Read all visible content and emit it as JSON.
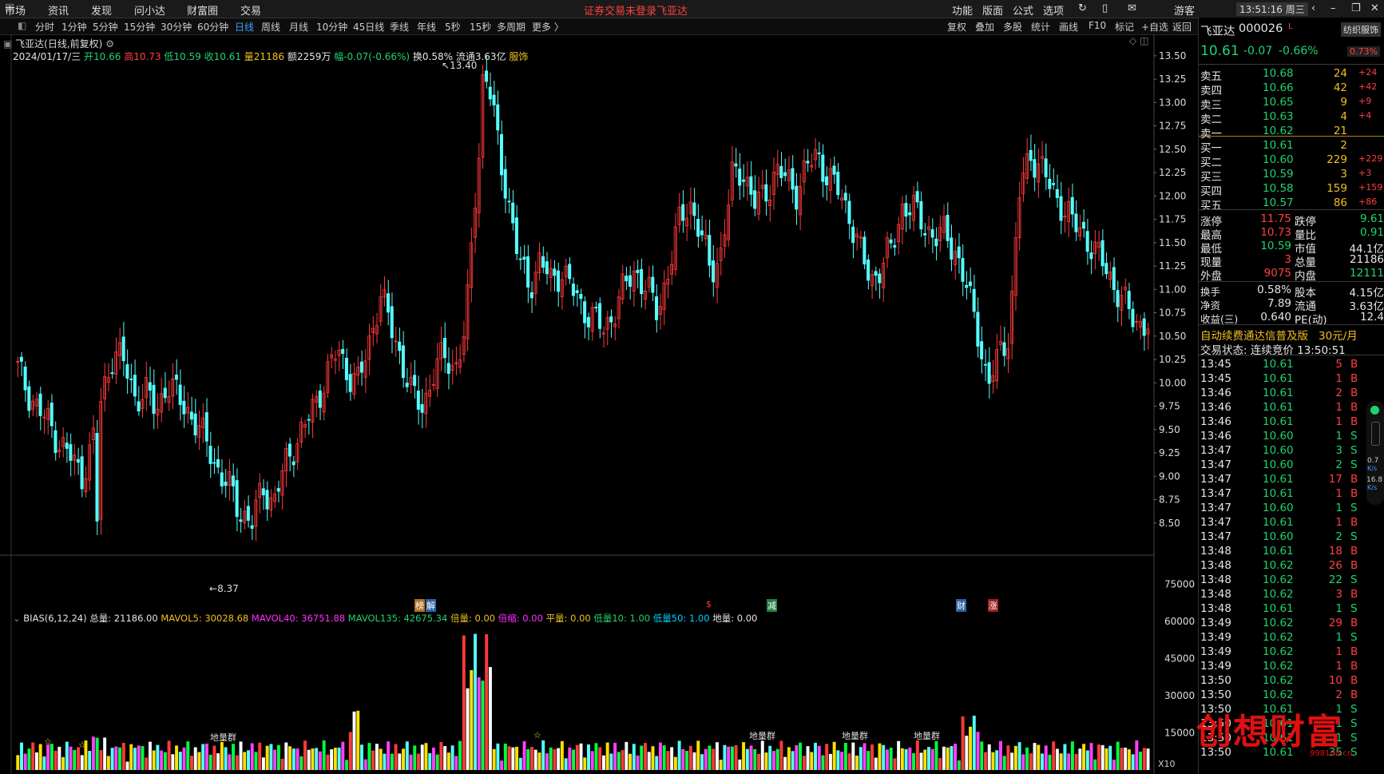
{
  "topmenu": [
    "市场",
    "资讯",
    "发现",
    "问小达",
    "财富圈",
    "交易"
  ],
  "notice": "证券交易未登录",
  "notice_stock": "飞亚达",
  "rightmenu": [
    "功能",
    "版面",
    "公式",
    "选项"
  ],
  "guest": "游客",
  "clock": "13:51:16 周三",
  "periods": [
    "分时",
    "1分钟",
    "5分钟",
    "15分钟",
    "30分钟",
    "60分钟",
    "日线",
    "周线",
    "月线",
    "10分钟",
    "45日线",
    "季线",
    "年线",
    "5秒",
    "15秒",
    "多周期",
    "更多 〉"
  ],
  "active_period": "日线",
  "tools": [
    "复权",
    "叠加",
    "多股",
    "统计",
    "画线",
    "F10",
    "标记",
    "+自选",
    "返回"
  ],
  "chart_title": "飞亚达(日线,前复权)",
  "info_date": "2024/01/17/三",
  "info_open": "开10.66",
  "info_high": "高10.73",
  "info_low": "低10.59",
  "info_close": "收10.61",
  "info_vol": "量21186",
  "info_amt": "额2259万",
  "info_chg": "幅-0.07(-0.66%)",
  "info_turn": "换0.58%",
  "info_float": "流通3.63亿",
  "info_sector": "服饰",
  "max_label": "13.40",
  "min_label": "8.37",
  "markers": [
    "榜",
    "解",
    "$",
    "减",
    "财",
    "涨"
  ],
  "vol_indicator": {
    "name": "BIAS(6,12,24)",
    "total": "总量: 21186.00",
    "mavol5": "MAVOL5: 30028.68",
    "mavol40": "MAVOL40: 36751.88",
    "mavol135": "MAVOL135: 42675.34",
    "beiliang": "倍量: 0.00",
    "beisuo": "倍缩: 0.00",
    "pingliang": "平量: 0.00",
    "diliang10": "低量10: 1.00",
    "diliang50": "低量50: 1.00",
    "diliang": "地量: 0.00"
  },
  "vol_labels": [
    "地量群",
    "地量群",
    "地量群",
    "地量群"
  ],
  "x10": "X10",
  "chart_data": {
    "type": "candlestick",
    "ylim": [
      8.25,
      13.55
    ],
    "yticks": [
      8.5,
      8.75,
      9.0,
      9.25,
      9.5,
      9.75,
      10.0,
      10.25,
      10.5,
      10.75,
      11.0,
      11.25,
      11.5,
      11.75,
      12.0,
      12.25,
      12.5,
      12.75,
      13.0,
      13.25,
      13.5
    ],
    "close_path": [
      10.15,
      9.9,
      9.7,
      9.55,
      9.35,
      9.2,
      9.0,
      9.35,
      9.9,
      10.35,
      10.2,
      9.85,
      9.9,
      9.7,
      10.0,
      9.85,
      9.7,
      9.5,
      9.3,
      9.0,
      8.85,
      8.6,
      8.5,
      8.9,
      8.7,
      9.1,
      9.35,
      9.55,
      9.8,
      10.1,
      10.35,
      10.1,
      10.0,
      10.45,
      10.95,
      10.6,
      10.25,
      9.85,
      9.75,
      10.1,
      10.3,
      10.15,
      10.55,
      12.2,
      13.3,
      12.6,
      11.95,
      11.3,
      11.05,
      11.3,
      11.1,
      11.2,
      11.0,
      10.8,
      10.7,
      10.55,
      10.8,
      11.05,
      11.2,
      11.0,
      10.75,
      11.2,
      11.7,
      11.95,
      11.6,
      11.2,
      11.4,
      12.2,
      12.3,
      11.9,
      12.0,
      12.25,
      12.2,
      12.05,
      12.3,
      12.45,
      12.2,
      12.05,
      11.8,
      11.4,
      11.1,
      11.25,
      11.45,
      11.9,
      11.85,
      11.7,
      11.55,
      11.6,
      11.4,
      11.0,
      10.6,
      9.95,
      10.3,
      10.55,
      12.1,
      12.45,
      12.3,
      12.05,
      11.9,
      11.7,
      11.6,
      11.4,
      11.25,
      11.0,
      10.8,
      10.65,
      10.61
    ],
    "ohlc_labels": {
      "max": 13.4,
      "min": 8.37
    },
    "volume_ylim": [
      0,
      80000
    ],
    "volume_yticks": [
      15000,
      30000,
      45000,
      60000,
      75000
    ]
  },
  "quote": {
    "name": "飞亚达",
    "code": "000026",
    "badge": "L",
    "btn": "纺织服饰",
    "price": "10.61",
    "chg": "-0.07",
    "pct": "-0.66%",
    "sector_pct": "0.73%",
    "asks": [
      {
        "label": "卖五",
        "price": "10.68",
        "vol": "24",
        "delta": "+24"
      },
      {
        "label": "卖四",
        "price": "10.66",
        "vol": "42",
        "delta": "+42"
      },
      {
        "label": "卖三",
        "price": "10.65",
        "vol": "9",
        "delta": "+9"
      },
      {
        "label": "卖二",
        "price": "10.63",
        "vol": "4",
        "delta": "+4"
      },
      {
        "label": "卖一",
        "price": "10.62",
        "vol": "21",
        "delta": ""
      }
    ],
    "bids": [
      {
        "label": "买一",
        "price": "10.61",
        "vol": "2",
        "delta": ""
      },
      {
        "label": "买二",
        "price": "10.60",
        "vol": "229",
        "delta": "+229"
      },
      {
        "label": "买三",
        "price": "10.59",
        "vol": "3",
        "delta": "+3"
      },
      {
        "label": "买四",
        "price": "10.58",
        "vol": "159",
        "delta": "+159"
      },
      {
        "label": "买五",
        "price": "10.57",
        "vol": "86",
        "delta": "+86"
      }
    ],
    "stats": [
      {
        "l1": "涨停",
        "v1": "11.75",
        "l2": "跌停",
        "v2": "9.61"
      },
      {
        "l1": "最高",
        "v1": "10.73",
        "l2": "量比",
        "v2": "0.91"
      },
      {
        "l1": "最低",
        "v1": "10.59",
        "l2": "市值",
        "v2": "44.1亿"
      },
      {
        "l1": "现量",
        "v1": "3",
        "l2": "总量",
        "v2": "21186"
      },
      {
        "l1": "外盘",
        "v1": "9075",
        "l2": "内盘",
        "v2": "12111"
      }
    ],
    "stats2": [
      {
        "l1": "换手",
        "v1": "0.58%",
        "l2": "股本",
        "v2": "4.15亿"
      },
      {
        "l1": "净资",
        "v1": "7.89",
        "l2": "流通",
        "v2": "3.63亿"
      },
      {
        "l1": "收益(三)",
        "v1": "0.640",
        "l2": "PE(动)",
        "v2": "12.4"
      }
    ],
    "promo": "自动续费通达信普及版",
    "promo_price": "30元/月",
    "trade_status": "交易状态: 连续竞价 13:50:51",
    "ticks": [
      [
        "13:45",
        "10.61",
        "5",
        "B"
      ],
      [
        "13:45",
        "10.61",
        "1",
        "B"
      ],
      [
        "13:46",
        "10.61",
        "2",
        "B"
      ],
      [
        "13:46",
        "10.61",
        "1",
        "B"
      ],
      [
        "13:46",
        "10.61",
        "1",
        "B"
      ],
      [
        "13:46",
        "10.60",
        "1",
        "S"
      ],
      [
        "13:47",
        "10.60",
        "3",
        "S"
      ],
      [
        "13:47",
        "10.60",
        "2",
        "S"
      ],
      [
        "13:47",
        "10.61",
        "17",
        "B"
      ],
      [
        "13:47",
        "10.61",
        "1",
        "B"
      ],
      [
        "13:47",
        "10.60",
        "1",
        "S"
      ],
      [
        "13:47",
        "10.61",
        "1",
        "B"
      ],
      [
        "13:47",
        "10.60",
        "2",
        "S"
      ],
      [
        "13:48",
        "10.61",
        "18",
        "B"
      ],
      [
        "13:48",
        "10.62",
        "26",
        "B"
      ],
      [
        "13:48",
        "10.62",
        "22",
        "S"
      ],
      [
        "13:48",
        "10.62",
        "3",
        "B"
      ],
      [
        "13:48",
        "10.61",
        "1",
        "S"
      ],
      [
        "13:49",
        "10.62",
        "29",
        "B"
      ],
      [
        "13:49",
        "10.62",
        "1",
        "S"
      ],
      [
        "13:49",
        "10.62",
        "1",
        "B"
      ],
      [
        "13:49",
        "10.62",
        "1",
        "B"
      ],
      [
        "13:50",
        "10.62",
        "10",
        "B"
      ],
      [
        "13:50",
        "10.62",
        "2",
        "B"
      ],
      [
        "13:50",
        "10.61",
        "1",
        "S"
      ],
      [
        "13:50",
        "10.61",
        "1",
        "S"
      ],
      [
        "13:50",
        "10.61",
        "1",
        "S"
      ],
      [
        "13:50",
        "10.61",
        "35",
        "S"
      ]
    ],
    "speed1": "0.7",
    "speed2": "16.8",
    "speed_unit": "K/s"
  },
  "watermark": "创想财富",
  "watermark_url": "998168.cn"
}
